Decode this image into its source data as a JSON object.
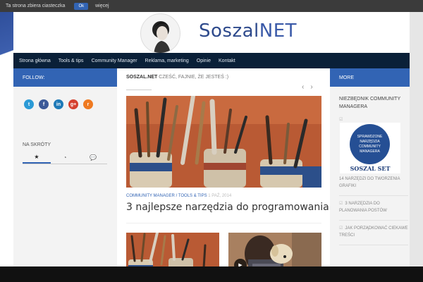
{
  "cookie_bar": {
    "text": "Ta strona zbiera ciasteczka",
    "ok_label": "Ok",
    "more_label": "więcej"
  },
  "logo": {
    "brand": "Soszal",
    "brand_suffix": "NET"
  },
  "nav": {
    "items": [
      "Strona główna",
      "Tools & tips",
      "Community Manager",
      "Reklama, marketing",
      "Opinie",
      "Kontakt"
    ]
  },
  "left_sidebar": {
    "header": "FOLLOW:",
    "social": [
      {
        "icon": "twitter-icon",
        "glyph": "t",
        "color": "#2b9ad6"
      },
      {
        "icon": "facebook-icon",
        "glyph": "f",
        "color": "#3b5998"
      },
      {
        "icon": "linkedin-icon",
        "glyph": "in",
        "color": "#1f7ab8"
      },
      {
        "icon": "google-plus-icon",
        "glyph": "g+",
        "color": "#d5412f"
      },
      {
        "icon": "rss-icon",
        "glyph": "r",
        "color": "#ef7a21"
      }
    ],
    "shortcuts_label": "NA SKRÓTY",
    "tabs": [
      {
        "icon": "star-icon",
        "glyph": "★"
      },
      {
        "icon": "clock-icon",
        "glyph": "◔"
      },
      {
        "icon": "comments-icon",
        "glyph": "💬"
      }
    ]
  },
  "main": {
    "tagline_site": "SOSZAL.NET",
    "tagline_text": " CZEŚĆ, FAJNIE, ŻE JESTEŚ :)",
    "prev_arrow": "‹",
    "next_arrow": "›",
    "featured": {
      "category1": "COMMUNITY MANAGER",
      "separator": " / ",
      "category2": "TOOLS & TIPS",
      "date": " 1 PAŹ, 2014",
      "title": "3 najlepsze narzędzia do programowania"
    },
    "play_icon": "▶"
  },
  "right_sidebar": {
    "header": "MORE",
    "title": "NIEZBĘDNIK COMMUNITY MANAGERA",
    "promo_circle_text": "SPRAWDZONE NARZĘDZIA COMMUNITY MANAGERA",
    "promo_brand": "SOSZAL SET",
    "list": [
      "14 NARZĘDZI DO TWORZENIA GRAFIKI",
      "3 NARZĘDZIA DO PLANOWANIA POSTÓW",
      "JAK PORZĄDKOWAĆ CIEKAWE TREŚCI"
    ]
  }
}
